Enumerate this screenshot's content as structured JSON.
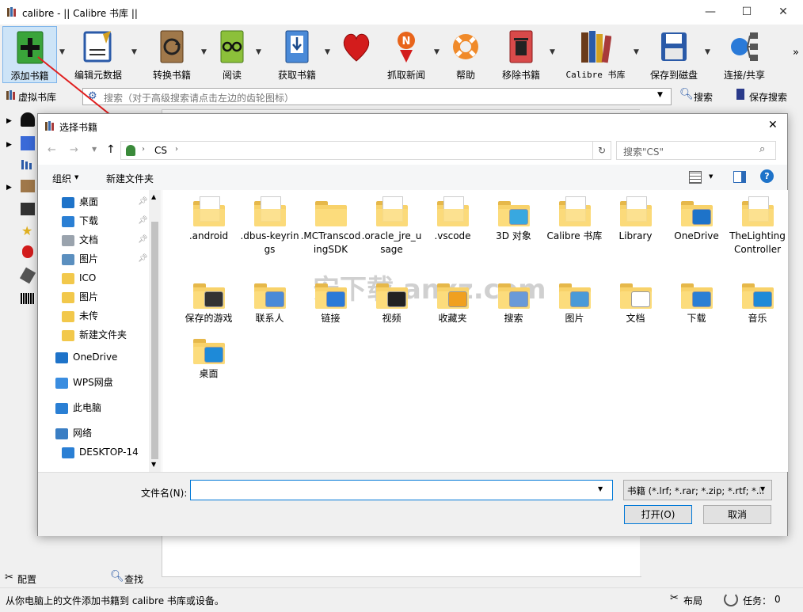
{
  "window": {
    "title": "calibre - || Calibre 书库 ||",
    "minimize": "—",
    "maximize": "☐",
    "close": "✕"
  },
  "toolbar": {
    "items": [
      {
        "label": "添加书籍",
        "icon": "add-book-icon"
      },
      {
        "label": "编辑元数据",
        "icon": "edit-metadata-icon"
      },
      {
        "label": "转换书籍",
        "icon": "convert-book-icon"
      },
      {
        "label": "阅读",
        "icon": "read-icon"
      },
      {
        "label": "获取书籍",
        "icon": "get-books-icon"
      },
      {
        "label": "",
        "icon": "heart-icon"
      },
      {
        "label": "抓取新闻",
        "icon": "fetch-news-icon"
      },
      {
        "label": "帮助",
        "icon": "help-lifebuoy-icon"
      },
      {
        "label": "移除书籍",
        "icon": "remove-book-icon"
      },
      {
        "label": "Calibre 书库",
        "icon": "library-icon"
      },
      {
        "label": "保存到磁盘",
        "icon": "save-disk-icon"
      },
      {
        "label": "连接/共享",
        "icon": "connect-share-icon"
      }
    ],
    "overflow": "»"
  },
  "searchbar": {
    "virtual_library": "虚拟书库",
    "placeholder": "搜索（对于高级搜索请点击左边的齿轮图标）",
    "search_label": "搜索",
    "save_search_label": "保存搜索"
  },
  "leftpane": {
    "config": "配置",
    "find": "查找"
  },
  "status": {
    "message": "从你电脑上的文件添加书籍到 calibre 书库或设备。",
    "layout": "布局",
    "jobs": "任务：",
    "jobs_count": "0"
  },
  "dialog": {
    "title": "选择书籍",
    "close": "✕",
    "path": [
      "CS"
    ],
    "search_placeholder": "搜索\"CS\"",
    "organize": "组织",
    "new_folder": "新建文件夹",
    "nav": [
      {
        "label": "桌面",
        "pinned": true,
        "color": "#1e73c9"
      },
      {
        "label": "下载",
        "pinned": true,
        "color": "#2a7fd4"
      },
      {
        "label": "文档",
        "pinned": true,
        "color": "#9aa3ad"
      },
      {
        "label": "图片",
        "pinned": true,
        "color": "#5b8fbf"
      },
      {
        "label": "ICO",
        "pinned": false,
        "color": "#f2c84b"
      },
      {
        "label": "图片",
        "pinned": false,
        "color": "#f2c84b"
      },
      {
        "label": "未传",
        "pinned": false,
        "color": "#f2c84b"
      },
      {
        "label": "新建文件夹",
        "pinned": false,
        "color": "#f2c84b"
      }
    ],
    "nav_groups": [
      {
        "label": "OneDrive",
        "color": "#1e73c9"
      },
      {
        "label": "WPS网盘",
        "color": "#3a8de0"
      },
      {
        "label": "此电脑",
        "color": "#2a7fd4"
      },
      {
        "label": "网络",
        "color": "#3a7ec4"
      },
      {
        "label": "DESKTOP-14",
        "color": "#2a7fd4"
      }
    ],
    "files": [
      {
        "name": ".android",
        "type": "doc-folder"
      },
      {
        "name": ".dbus-keyrings",
        "type": "doc-folder"
      },
      {
        "name": ".MCTranscodingSDK",
        "type": "plain-folder"
      },
      {
        "name": ".oracle_jre_usage",
        "type": "doc-folder"
      },
      {
        "name": ".vscode",
        "type": "doc-folder"
      },
      {
        "name": "3D 对象",
        "type": "3d-folder"
      },
      {
        "name": "Calibre 书库",
        "type": "doc-folder"
      },
      {
        "name": "Library",
        "type": "doc-folder"
      },
      {
        "name": "OneDrive",
        "type": "onedrive-folder"
      },
      {
        "name": "TheLightingController",
        "type": "doc-folder"
      },
      {
        "name": "保存的游戏",
        "type": "games-folder"
      },
      {
        "name": "联系人",
        "type": "contacts-folder"
      },
      {
        "name": "链接",
        "type": "links-folder"
      },
      {
        "name": "视频",
        "type": "videos-folder"
      },
      {
        "name": "收藏夹",
        "type": "favorites-folder"
      },
      {
        "name": "搜索",
        "type": "search-folder"
      },
      {
        "name": "图片",
        "type": "pictures-folder"
      },
      {
        "name": "文档",
        "type": "documents-folder"
      },
      {
        "name": "下载",
        "type": "downloads-folder"
      },
      {
        "name": "音乐",
        "type": "music-folder"
      },
      {
        "name": "桌面",
        "type": "desktop-folder"
      }
    ],
    "filename_label": "文件名(N):",
    "filename_value": "",
    "filter": "书籍 (*.lrf; *.rar; *.zip; *.rtf; *.li",
    "open": "打开(O)",
    "cancel": "取消"
  },
  "watermark": "安下载 anxz.com",
  "colors": {
    "accent": "#0078d7",
    "arrow": "#e02020"
  }
}
